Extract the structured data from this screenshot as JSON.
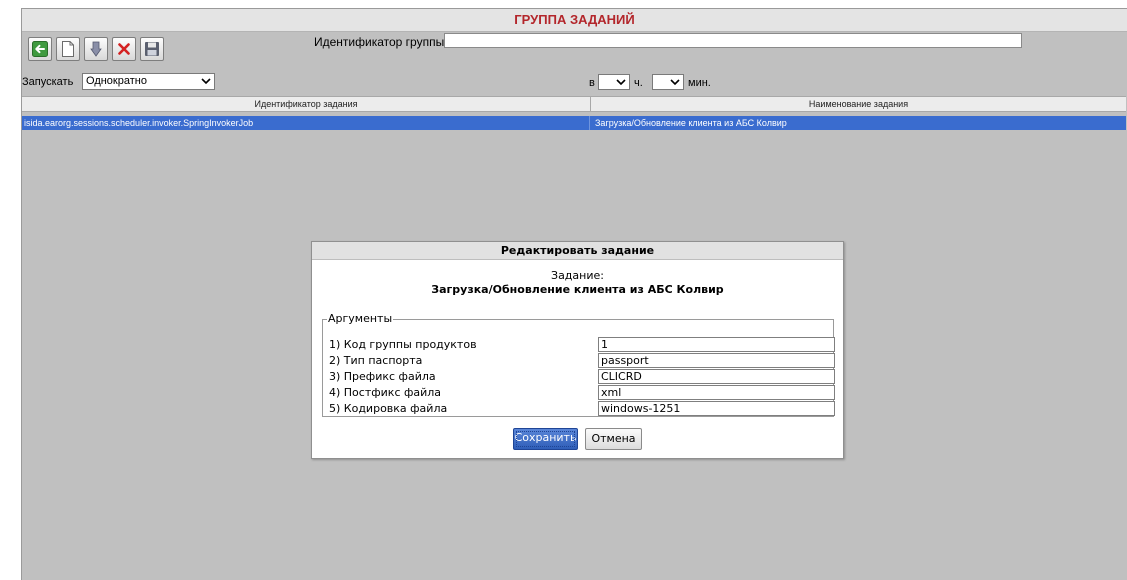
{
  "window": {
    "title": "ГРУППА ЗАДАНИЙ"
  },
  "toolbar": {
    "buttons": [
      {
        "name": "back",
        "icon": "back-arrow-icon"
      },
      {
        "name": "new",
        "icon": "new-document-icon"
      },
      {
        "name": "attach",
        "icon": "bookmark-icon"
      },
      {
        "name": "delete",
        "icon": "delete-x-icon"
      },
      {
        "name": "save",
        "icon": "floppy-disk-icon"
      }
    ]
  },
  "group": {
    "id_label": "Идентификатор группы:",
    "id_value": ""
  },
  "schedule": {
    "run_label": "Запускать",
    "run_value": "Однократно",
    "at_label": "в",
    "hours_value": "",
    "hours_label": "ч.",
    "minutes_value": "",
    "minutes_label": "мин."
  },
  "grid": {
    "columns": [
      "Идентификатор задания",
      "Наименование задания"
    ],
    "rows": [
      [
        "isida.earorg.sessions.scheduler.invoker.SpringInvokerJob",
        "Загрузка/Обновление клиента из АБС Колвир"
      ]
    ]
  },
  "dialog": {
    "title": "Редактировать задание",
    "task_label": "Задание:",
    "task_name": "Загрузка/Обновление клиента из АБС Колвир",
    "args_legend": "Аргументы",
    "args": [
      {
        "label": "1) Код группы продуктов",
        "value": "1"
      },
      {
        "label": "2) Тип паспорта",
        "value": "passport"
      },
      {
        "label": "3) Префикс файла",
        "value": "CLICRD"
      },
      {
        "label": "4) Постфикс файла",
        "value": "xml"
      },
      {
        "label": "5) Кодировка файла",
        "value": "windows-1251"
      }
    ],
    "save_label": "Сохранить",
    "cancel_label": "Отмена"
  },
  "colors": {
    "title_red": "#b3262b",
    "selection_blue": "#3a6ccf",
    "panel_gray": "#c0c0c0"
  }
}
